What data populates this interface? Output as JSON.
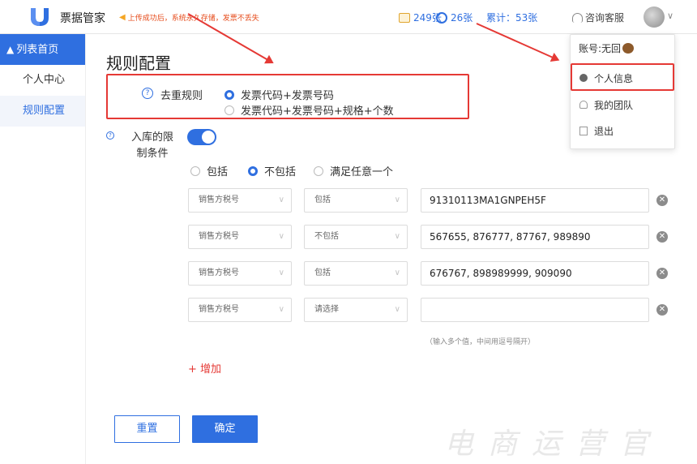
{
  "app": {
    "name": "票据管家",
    "notice": "上传成功后，系统永久存储，发票不丢失"
  },
  "stats": {
    "invoice_count": "249张",
    "search_count": "26张",
    "total": "累计：53张"
  },
  "service_label": "咨询客服",
  "sidebar": {
    "items": [
      {
        "label": "列表首页"
      },
      {
        "label": "个人中心"
      },
      {
        "label": "规则配置"
      }
    ]
  },
  "page": {
    "title": "规则配置"
  },
  "dedup": {
    "label": "去重规则",
    "options": [
      "发票代码+发票号码",
      "发票代码+发票号码+规格+个数"
    ],
    "selected": 0
  },
  "stock_condition": {
    "label": "入库的限制条件",
    "enabled": true,
    "modes": [
      "包括",
      "不包括",
      "满足任意一个"
    ],
    "selected_mode": 1
  },
  "rules": [
    {
      "field": "销售方税号",
      "op": "包括",
      "value": "91310113MA1GNPEH5F"
    },
    {
      "field": "销售方税号",
      "op": "不包括",
      "value": "567655, 876777, 87767, 989890"
    },
    {
      "field": "销售方税号",
      "op": "包括",
      "value": "676767, 898989999, 909090"
    },
    {
      "field": "销售方税号",
      "op": "请选择",
      "value": ""
    }
  ],
  "hint": "（输入多个值，中间用逗号隔开）",
  "add_label": "+ 增加",
  "buttons": {
    "reset": "重置",
    "confirm": "确定"
  },
  "user_menu": {
    "account": "账号:无回",
    "items": [
      {
        "label": "个人信息",
        "icon": "user-icon"
      },
      {
        "label": "我的团队",
        "icon": "team-icon"
      },
      {
        "label": "退出",
        "icon": "logout-icon"
      }
    ]
  },
  "watermark": "电商运营官",
  "colors": {
    "accent": "#2f6fe0",
    "highlight": "#e53935"
  }
}
